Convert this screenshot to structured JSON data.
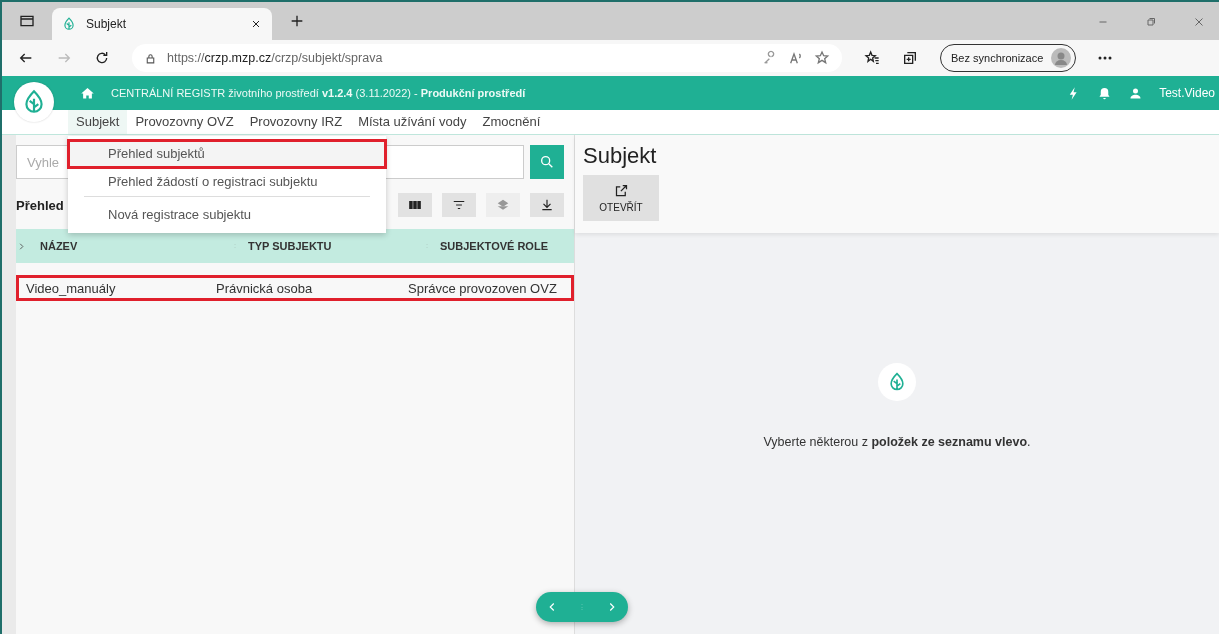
{
  "browser": {
    "tab": {
      "title": "Subjekt"
    },
    "url": {
      "scheme": "https://",
      "host": "crzp.mzp.cz",
      "path": "/crzp/subjekt/sprava"
    },
    "profile": "Bez synchronizace"
  },
  "header": {
    "title": "CENTRÁLNÍ REGISTR životního prostředí **v1.2.4** (3.11.2022) - **Produkční prostředí**",
    "user": "Test.Video"
  },
  "menu": [
    {
      "label": "Subjekt",
      "expanded": true
    },
    {
      "label": "Provozovny OVZ",
      "expanded": false
    },
    {
      "label": "Provozovny IRZ",
      "expanded": false
    },
    {
      "label": "Místa užívání vody",
      "expanded": false
    },
    {
      "label": "Zmocnění",
      "expanded": false
    }
  ],
  "dropdown": [
    {
      "label": "Přehled subjektů",
      "highlighted": true,
      "divider_after": false
    },
    {
      "label": "Přehled žádostí o registraci subjektu",
      "highlighted": false,
      "divider_after": true
    },
    {
      "label": "Nová registrace subjektu",
      "highlighted": false,
      "divider_after": false
    }
  ],
  "search": {
    "placeholder": "Vyhle"
  },
  "list_title": "Přehled",
  "toolbar": [
    {
      "kind": "columns",
      "disabled": false
    },
    {
      "kind": "filter",
      "disabled": false
    },
    {
      "kind": "layers",
      "disabled": true
    },
    {
      "kind": "download",
      "disabled": false
    }
  ],
  "table": {
    "columns": [
      "NÁZEV",
      "TYP SUBJEKTU",
      "SUBJEKTOVÉ ROLE"
    ],
    "rows": [
      {
        "cells": [
          "Video_manuály",
          "Právnická osoba",
          "Správce provozoven OVZ"
        ],
        "highlighted": true
      }
    ]
  },
  "detail": {
    "title": "Subjekt",
    "open_button": "OTEVŘÍT",
    "empty_message": "Vyberte některou z **položek ze seznamu vlevo**."
  }
}
